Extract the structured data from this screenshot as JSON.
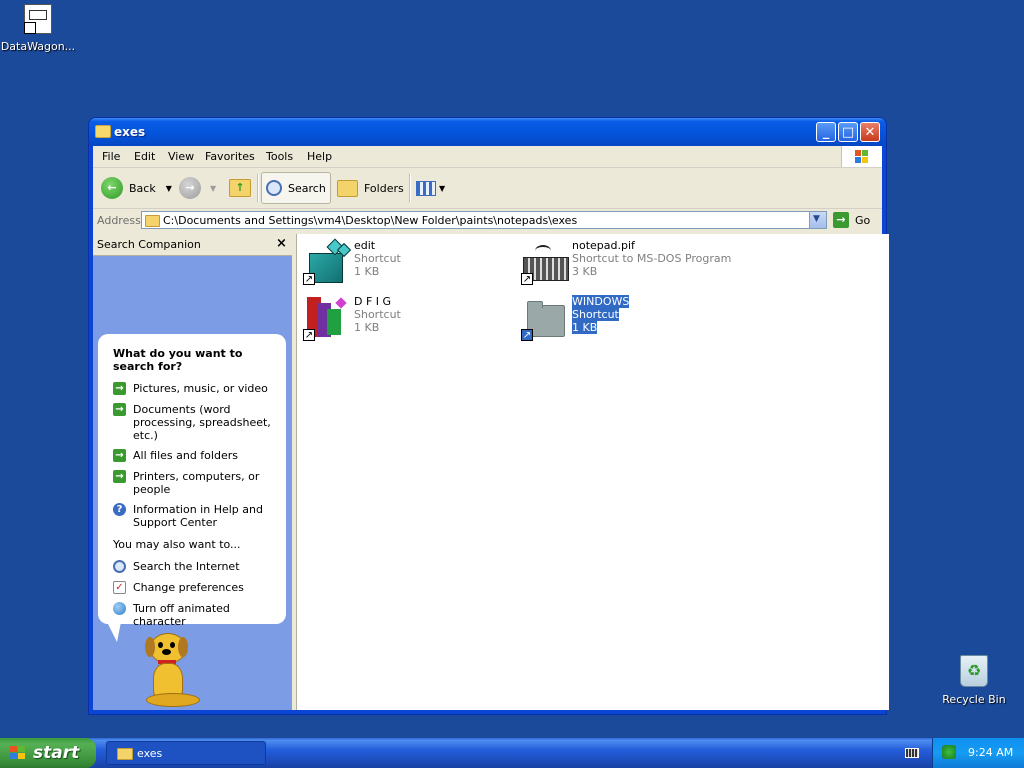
{
  "desktop": {
    "icon_top_left_label": "DataWagon...",
    "recycle_bin_label": "Recycle Bin"
  },
  "window": {
    "title": "exes",
    "menu": [
      "File",
      "Edit",
      "View",
      "Favorites",
      "Tools",
      "Help"
    ],
    "toolbar": {
      "back_label": "Back",
      "search_label": "Search",
      "folders_label": "Folders"
    },
    "address": {
      "label": "Address",
      "path": "C:\\Documents and Settings\\vm4\\Desktop\\New Folder\\paints\\notepads\\exes",
      "go_label": "Go"
    },
    "companion": {
      "header": "Search Companion",
      "question": "What do you want to search for?",
      "options": [
        "Pictures, music, or video",
        "Documents (word processing, spreadsheet, etc.)",
        "All files and folders",
        "Printers, computers, or people",
        "Information in Help and Support Center"
      ],
      "also_title": "You may also want to...",
      "also": [
        "Search the Internet",
        "Change preferences",
        "Turn off animated character"
      ]
    },
    "files": [
      {
        "name": "edit",
        "type": "Shortcut",
        "size": "1 KB"
      },
      {
        "name": "notepad.pif",
        "type": "Shortcut to MS-DOS Program",
        "size": "3 KB"
      },
      {
        "name": "D F I G",
        "type": "Shortcut",
        "size": "1 KB"
      },
      {
        "name": "WINDOWS",
        "type": "Shortcut",
        "size": "1 KB"
      }
    ]
  },
  "taskbar": {
    "start_label": "start",
    "task_label": "exes",
    "clock": "9:24 AM"
  }
}
